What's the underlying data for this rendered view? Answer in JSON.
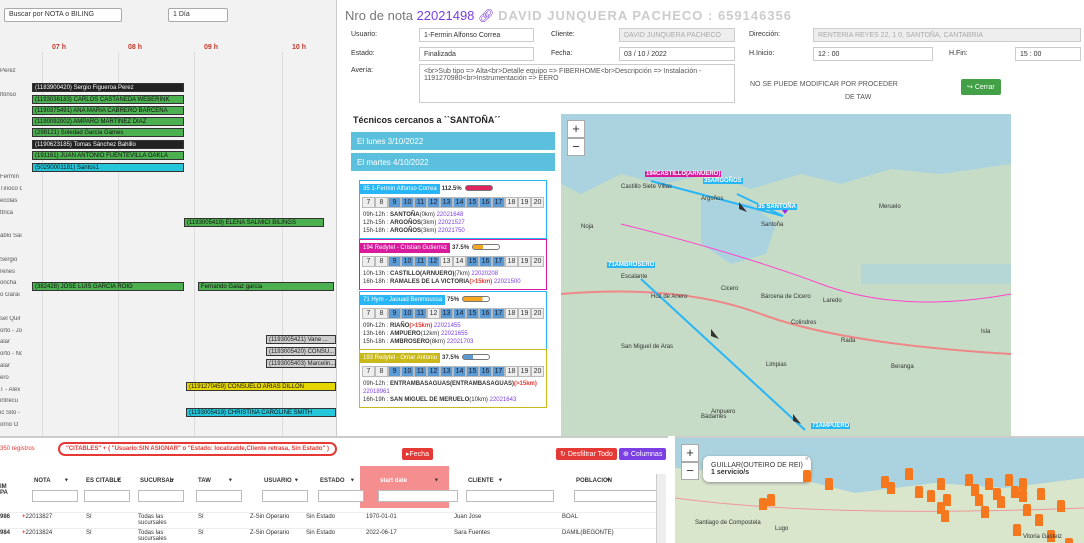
{
  "schedule": {
    "search_select": "Buscar por NOTA o BILING",
    "range_select": "1 Día",
    "hours": [
      "07 h",
      "08 h",
      "09 h",
      "10 h"
    ],
    "row_labels": [
      "Perez",
      "",
      "lfonso",
      "",
      "",
      "",
      "",
      "",
      "",
      "Fermín",
      "Tinoco Corr",
      "ecolas",
      "ttrica",
      "",
      "ablo Sainz",
      "",
      "Sergio",
      "renes",
      "oncha",
      "o Garai",
      "",
      "sel Quir",
      "orto - José",
      "alar",
      "orto - Noel",
      "alar",
      "ero",
      "T - Alex",
      "intrecu",
      "ic Sito -",
      "orrio O"
    ],
    "jobs": [
      {
        "text": "(1183900420) Sergio Figueroa Perez",
        "cls": "b"
      },
      {
        "text": "(1193036183) CARLOS CASTAÑEDA WEBERINK",
        "cls": "g"
      },
      {
        "text": "(1190375491) ANA MARIA CABRERO BARCENA",
        "cls": "g"
      },
      {
        "text": "(1190092002) AMPARO MARTINEZ DIAZ",
        "cls": "g"
      },
      {
        "text": "(298121) Soledad García Gámes",
        "cls": "g"
      },
      {
        "text": "(1190623185) Tomas Sánchez Bahillo",
        "cls": "b"
      },
      {
        "text": "(191161) JUAN ANTONIO FUENTEVILLA OAKLA",
        "cls": "g"
      },
      {
        "text": "(50290001181) Santos1",
        "cls": "c"
      },
      {
        "text": "(1193005419) ELENA SALMICI BILINGS",
        "cls": "g"
      },
      {
        "text": "(382428) JOSÉ LUIS GARCIA ROIG",
        "cls": "g"
      },
      {
        "text": "Fernando Galaz garcia",
        "cls": "g"
      },
      {
        "text": "(1193005421) Vane ...",
        "cls": "gr"
      },
      {
        "text": "(1193005420) CONSU...",
        "cls": "gr"
      },
      {
        "text": "(1193005403) Marcelin...",
        "cls": "gr"
      },
      {
        "text": "(1191270459) CONSUELO ARIAS DILLON",
        "cls": "y"
      },
      {
        "text": "(1193005419) CHRISTINA CAROLINE SMITH",
        "cls": "c"
      }
    ]
  },
  "modal": {
    "title_prefix": "Nro de nota",
    "note_id": "22021498",
    "title_suffix": "DAVID JUNQUERA PACHECO : 659146356",
    "usuario_label": "Usuario:",
    "usuario_value": "1-Fermin Alfonso Correa",
    "cliente_label": "Cliente:",
    "cliente_value": "DAVID JUNQUERA PACHECO",
    "direccion_label": "Dirección:",
    "direccion_value": "RENTERIA REYES 22, 1 0, SANTOÑA, CANTABRIA",
    "estado_label": "Estado:",
    "estado_value": "Finalizada",
    "fecha_label": "Fecha:",
    "fecha_value": "03 / 10 / 2022",
    "hinicio_label": "H.Inicio:",
    "hinicio_value": "12 : 00",
    "hfin_label": "H.Fin:",
    "hfin_value": "15 : 00",
    "averia_label": "Avería:",
    "averia_value": "<br>Sub tipo => Alta<br>Detalle equipo => FIBERHOME<br>Descripción => Instalación - 1191270980<br>Instrumentación => EERO",
    "note_line1": "NO SE PUEDE MODIFICAR POR PROCEDER",
    "note_line2": "DE TAW",
    "close_label": "Cerrar",
    "tech_title": "Técnicos cercanos a ``SANTOÑA´´",
    "day1": "El lunes 3/10/2022",
    "day2": "El martes 4/10/2022",
    "hour_cells": [
      "7",
      "8",
      "9",
      "10",
      "11",
      "12",
      "13",
      "14",
      "15",
      "16",
      "17",
      "18",
      "19",
      "20"
    ],
    "cards": [
      {
        "name": "35 1-Fermin Alfonso Correa",
        "pct": "112.5%",
        "color": "#29b6f6",
        "barcolor": "#e0245e",
        "fill": 100,
        "on": [
          2,
          3,
          4,
          5,
          6,
          7,
          8,
          9,
          10
        ],
        "lines": [
          {
            "t": "09h-12h : ",
            "p": "SANTOÑA",
            "k": "(0km) ",
            "n": "22021648"
          },
          {
            "t": "12h-15h : ",
            "p": "ARGOÑOS",
            "k": "(3km) ",
            "n": "22021527"
          },
          {
            "t": "15h-18h : ",
            "p": "ARGOÑOS",
            "k": "(3km) ",
            "n": "22021750"
          }
        ]
      },
      {
        "name": "194 Redytel - Cristian Gutierrez",
        "pct": "37.5%",
        "color": "#d81b9c",
        "barcolor": "#f5a623",
        "fill": 38,
        "on": [
          2,
          3,
          4,
          5,
          8,
          9,
          10
        ],
        "lines": [
          {
            "t": "10h-13h : ",
            "p": "CASTILLO(ARNUERO)",
            "k": "(7km) ",
            "n": "22020208"
          },
          {
            "t": "16h-18h : ",
            "p": "RAMALES DE LA VICTORIA",
            "k": "(>15km) ",
            "n": "22021500"
          }
        ]
      },
      {
        "name": "71 Hym - Jaouad Benmoussa",
        "pct": "75%",
        "color": "#29b6f6",
        "barcolor": "#f5a623",
        "fill": 75,
        "on": [
          2,
          3,
          4,
          6,
          7,
          8,
          9,
          10
        ],
        "lines": [
          {
            "t": "09h-12h : ",
            "p": "RIAÑO",
            "k": "(>15km) ",
            "n": "22021455"
          },
          {
            "t": "13h-16h : ",
            "p": "AMPUERO",
            "k": "(12km) ",
            "n": "22021655"
          },
          {
            "t": "15h-18h : ",
            "p": "AMBROSERO",
            "k": "(8km) ",
            "n": "22021703"
          }
        ]
      },
      {
        "name": "193 Redytel - Omar Antonio",
        "pct": "37.5%",
        "color": "#c9b81a",
        "barcolor": "#5b9bd5",
        "fill": 38,
        "on": [
          2,
          3,
          4,
          5,
          6,
          7,
          8,
          9,
          10
        ],
        "lines": [
          {
            "t": "09h-12h : ",
            "p": "ENTRAMBASAGUAS(ENTRAMBASAGUAS)",
            "k": "(>15km) ",
            "n": "22018961"
          },
          {
            "t": "16h-19h : ",
            "p": "SAN MIGUEL DE MERUELO",
            "k": "(10km) ",
            "n": "22021643"
          }
        ]
      }
    ],
    "map_tags": [
      {
        "t": "194CASTILLO(ARNUERO)",
        "c": "#d81b9c"
      },
      {
        "t": "35ARGOÑOS",
        "c": "#29b6f6"
      },
      {
        "t": "35 SANTOÑA",
        "c": "#29b6f6"
      },
      {
        "t": "71AMBROSERO",
        "c": "#29b6f6"
      },
      {
        "t": "71AMPUERO",
        "c": "#29b6f6"
      }
    ],
    "map_places": [
      "Castillo Siete Villas",
      "Argoños",
      "Santoña",
      "Laredo",
      "Colindres",
      "Limpias",
      "Rada",
      "Ampuero",
      "Bádames",
      "Hoz de Anero",
      "San Miguel de Aras",
      "Cicero",
      "Escalante",
      "Noja",
      "Isla",
      "Meruelo",
      "Beranga",
      "Bárcena de Cicero"
    ]
  },
  "table": {
    "count": "350 registros",
    "filter_text": "\"CITABLES\" + ( \"Usuario:SIN ASIGNAR\" o \"Estado: Iocalizable,Cliente retrasa, Sin Estado\" )",
    "fecha_btn": "Fecha",
    "desfiltrar_btn": "Desfiltrar Todo",
    "columnas_btn": "Columnas",
    "headers": [
      "NOTA",
      "ES CITABLE",
      "SUCURSAL",
      "TAW",
      "USUARIO",
      "ESTADO",
      "start date",
      "CLIENTE",
      "POBLACION"
    ],
    "rows": [
      {
        "num": "986",
        "nota": "22013827",
        "citable": "SI",
        "sucursal": "Todas las sucursales",
        "taw": "SI",
        "usuario": "Z-Sin Operario",
        "estado": "Sin Estado",
        "start": "1970-01-01",
        "cliente": "Juan Jose",
        "poblacion": "BOAL"
      },
      {
        "num": "984",
        "nota": "22013824",
        "citable": "SI",
        "sucursal": "Todas las sucursales",
        "taw": "SI",
        "usuario": "Z-Sin Operario",
        "estado": "Sin Estado",
        "start": "2022-06-17",
        "cliente": "Sara Fuentes",
        "poblacion": "DAMIL(BEGONTE)"
      }
    ],
    "side_lbl": "IM PA"
  },
  "map2": {
    "popup_title": "GUILLAR(OUTEIRO DE REI)",
    "popup_count": "1 servicio/s",
    "places": [
      "Santiago de Compostela",
      "Lugo",
      "Vitoria Gasteiz"
    ]
  }
}
